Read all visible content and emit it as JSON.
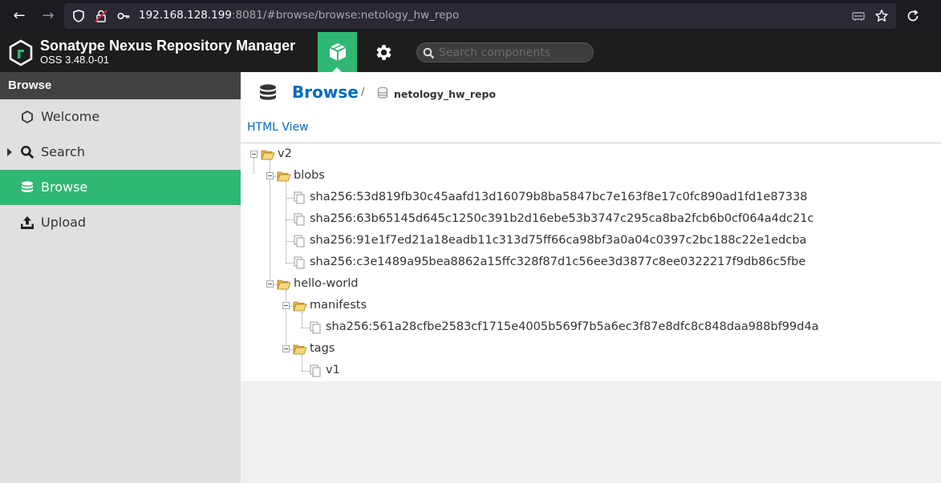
{
  "browser": {
    "url_host": "192.168.128.199",
    "url_rest": ":8081/#browse/browse:netology_hw_repo"
  },
  "header": {
    "title": "Sonatype Nexus Repository Manager",
    "version": "OSS 3.48.0-01",
    "search_placeholder": "Search components",
    "accent_color": "#2fb873"
  },
  "sidebar": {
    "heading": "Browse",
    "items": [
      {
        "label": "Welcome",
        "icon": "hexagon-icon"
      },
      {
        "label": "Search",
        "icon": "search-icon"
      },
      {
        "label": "Browse",
        "icon": "database-icon",
        "active": true
      },
      {
        "label": "Upload",
        "icon": "upload-icon"
      }
    ]
  },
  "main": {
    "title": "Browse",
    "separator": "/",
    "repository": "netology_hw_repo",
    "html_view_link": "HTML View"
  },
  "tree": {
    "v2": "v2",
    "blobs": "blobs",
    "blob_items": [
      "sha256:53d819fb30c45aafd13d16079b8ba5847bc7e163f8e17c0fc890ad1fd1e87338",
      "sha256:63b65145d645c1250c391b2d16ebe53b3747c295ca8ba2fcb6b0cf064a4dc21c",
      "sha256:91e1f7ed21a18eadb11c313d75ff66ca98bf3a0a04c0397c2bc188c22e1edcba",
      "sha256:c3e1489a95bea8862a15ffc328f87d1c56ee3d3877c8ee0322217f9db86c5fbe"
    ],
    "hello_world": "hello-world",
    "manifests": "manifests",
    "manifest_item": "sha256:561a28cfbe2583cf1715e4005b569f7b5a6ec3f87e8dfc8c848daa988bf99d4a",
    "tags": "tags",
    "tag_item": "v1"
  }
}
